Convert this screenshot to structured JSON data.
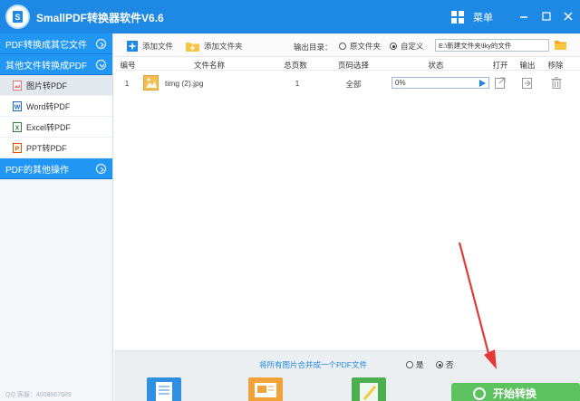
{
  "app": {
    "title": "SmallPDF转换器软件V6.6",
    "menu_label": "菜单"
  },
  "sidebar": {
    "sections": [
      {
        "label": "PDF转换成其它文件"
      },
      {
        "label": "其他文件转换成PDF"
      },
      {
        "label": "PDF的其他操作"
      }
    ],
    "items": [
      {
        "label": "图片转PDF",
        "active": true,
        "icon": "image-icon"
      },
      {
        "label": "Word转PDF",
        "icon": "word-icon"
      },
      {
        "label": "Excel转PDF",
        "icon": "excel-icon"
      },
      {
        "label": "PPT转PDF",
        "icon": "ppt-icon"
      }
    ],
    "footer_text": "QQ 客服：4008867689"
  },
  "toolbar": {
    "add_file": "添加文件",
    "add_folder": "添加文件夹",
    "output_dir_label": "输出目录：",
    "radio_original": "原文件夹",
    "radio_custom": "自定义",
    "selected_radio": "custom",
    "output_path": "E:\\新建文件夹\\lky的文件"
  },
  "table": {
    "columns": [
      "编号",
      "文件名称",
      "总页数",
      "页码选择",
      "状态",
      "打开",
      "输出",
      "移除"
    ],
    "rows": [
      {
        "index": "1",
        "filename": "timg (2).jpg",
        "pages": "1",
        "page_select": "全部",
        "status": "0%",
        "progress": 0
      }
    ]
  },
  "merge": {
    "label": "将所有图片合并成一个PDF文件",
    "yes": "是",
    "no": "否",
    "selected": "no"
  },
  "start_button": {
    "label": "开始转换"
  },
  "colors": {
    "titlebar": "#1e88e5",
    "sidebar_header": "#2196f3",
    "start_button": "#5cc25f",
    "annotation_arrow": "#e53935"
  }
}
